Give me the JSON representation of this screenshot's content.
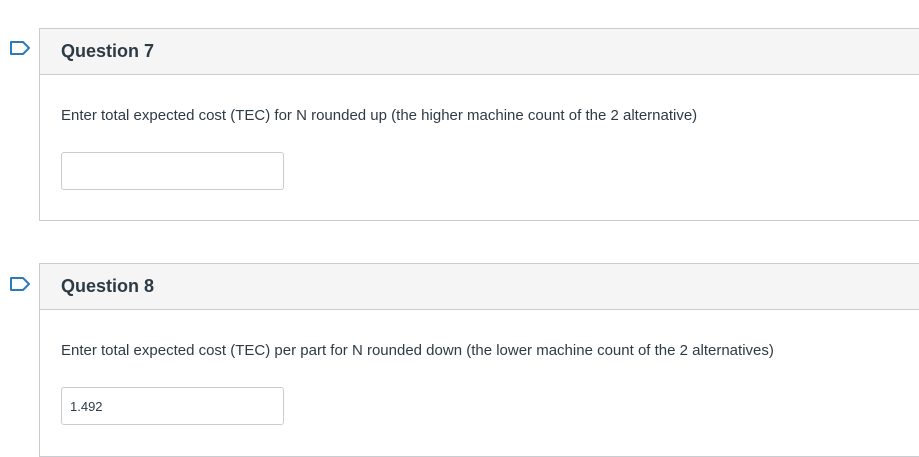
{
  "questions": [
    {
      "title": "Question 7",
      "text": "Enter total expected cost (TEC) for N rounded up (the higher machine count of the 2 alternative)",
      "answer_value": ""
    },
    {
      "title": "Question 8",
      "text": "Enter total expected cost (TEC) per part for N rounded down (the lower machine count of the 2 alternatives)",
      "answer_value": "1.492"
    }
  ],
  "flag_icon": "bookmark-flag-icon",
  "colors": {
    "flag": "#2b7abc",
    "header_bg": "#f5f5f5",
    "border": "#c7cdd1",
    "text": "#2d3b45"
  }
}
